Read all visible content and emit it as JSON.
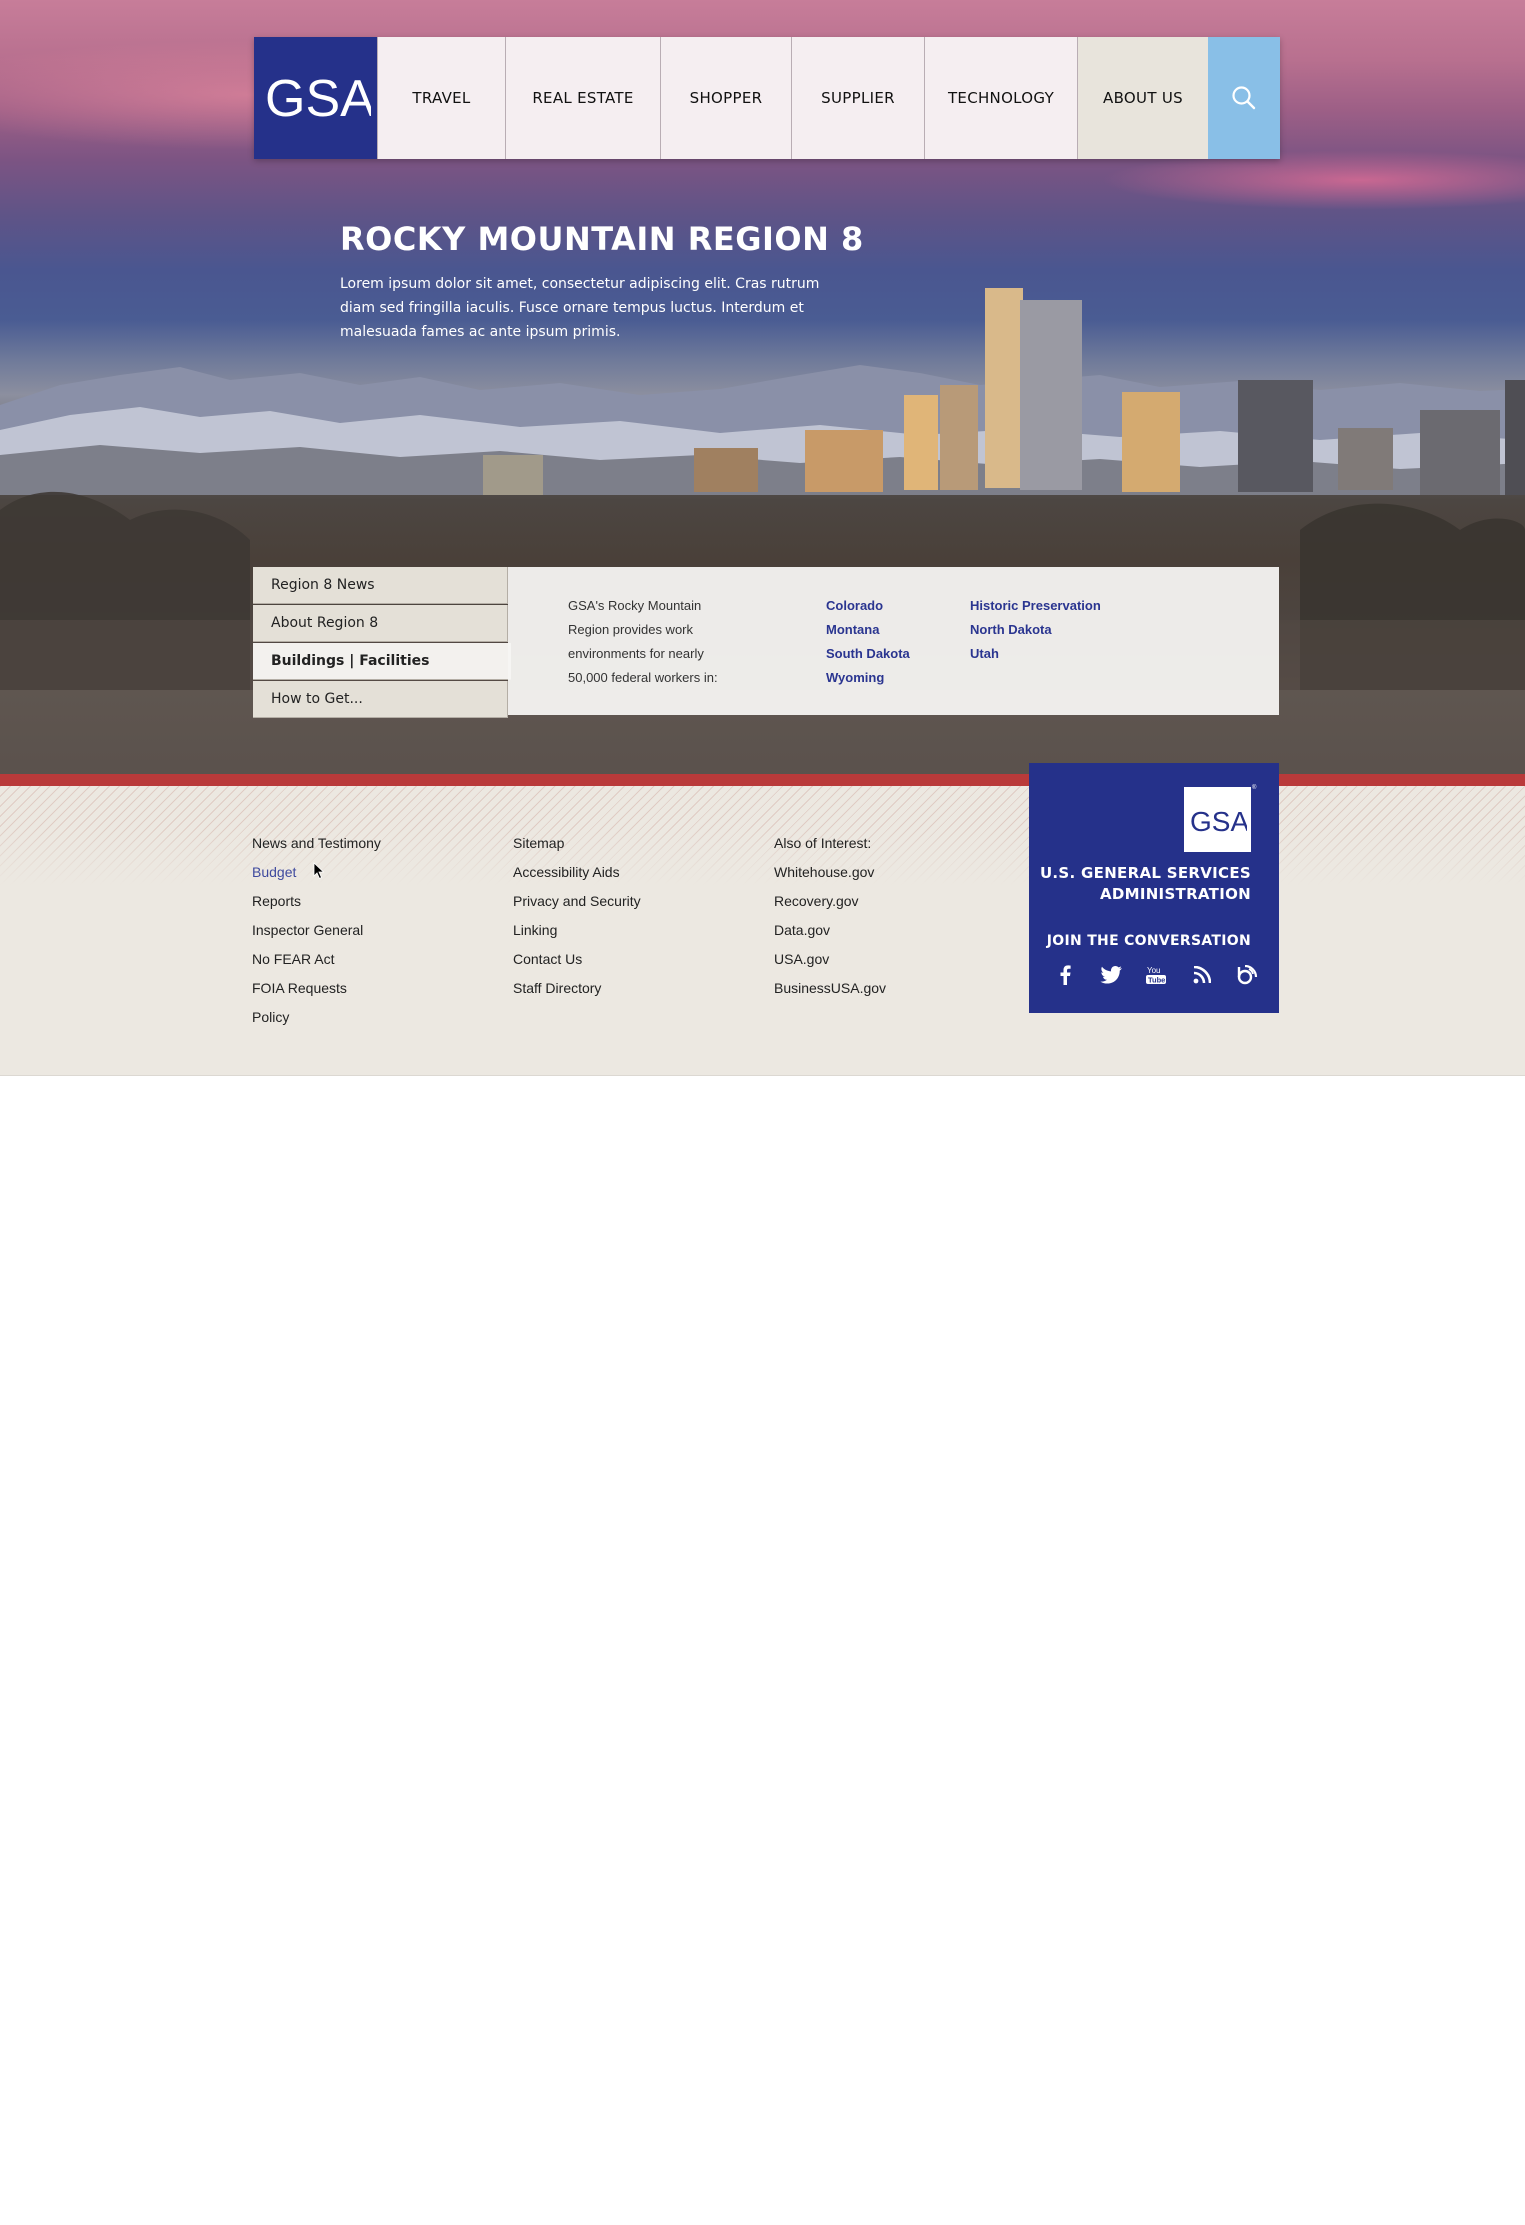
{
  "logo": {
    "text": "GSA"
  },
  "nav": {
    "items": [
      {
        "label": "TRAVEL"
      },
      {
        "label": "REAL ESTATE"
      },
      {
        "label": "SHOPPER"
      },
      {
        "label": "SUPPLIER"
      },
      {
        "label": "TECHNOLOGY"
      },
      {
        "label": "ABOUT US",
        "active": true
      }
    ],
    "search_icon": "search-icon"
  },
  "hero": {
    "title": "ROCKY MOUNTAIN REGION 8",
    "description": "Lorem ipsum dolor sit amet, consectetur adipiscing elit. Cras rutrum diam sed fringilla iaculis. Fusce ornare tempus luctus. Interdum et malesuada fames ac ante ipsum primis."
  },
  "subnav": {
    "items": [
      {
        "label": "Region 8 News"
      },
      {
        "label": "About Region 8"
      },
      {
        "label": "Buildings | Facilities",
        "active": true
      },
      {
        "label": "How to Get..."
      }
    ]
  },
  "panel": {
    "text_lines": [
      "GSA's Rocky Mountain",
      "Region provides work",
      "environments for nearly",
      "50,000 federal workers in:"
    ],
    "links_col1": [
      "Colorado",
      "Montana",
      "South Dakota",
      "Wyoming"
    ],
    "links_col2": [
      "Historic Preservation",
      "North Dakota",
      "Utah"
    ]
  },
  "footer": {
    "col1": [
      "News and Testimony",
      "Budget",
      "Reports",
      "Inspector General",
      "No FEAR Act",
      "FOIA Requests",
      "Policy"
    ],
    "col2": [
      "Sitemap",
      "Accessibility Aids",
      "Privacy and Security",
      "Linking",
      "Contact Us",
      "Staff Directory"
    ],
    "col3": [
      "Also of Interest:",
      "Whitehouse.gov",
      "Recovery.gov",
      "Data.gov",
      "USA.gov",
      "BusinessUSA.gov"
    ]
  },
  "gsa_box": {
    "logo_text": "GSA",
    "registered": "®",
    "name_line1": "U.S. GENERAL SERVICES",
    "name_line2": "ADMINISTRATION",
    "join": "JOIN THE CONVERSATION",
    "social_icons": [
      "facebook-icon",
      "twitter-icon",
      "youtube-icon",
      "rss-icon",
      "blog-icon"
    ]
  },
  "colors": {
    "brand_navy": "#25318a",
    "search_blue": "#89bfe7",
    "link_blue": "#2a3590",
    "footer_red": "#b93a3a",
    "footer_bg": "#ece8e1"
  }
}
